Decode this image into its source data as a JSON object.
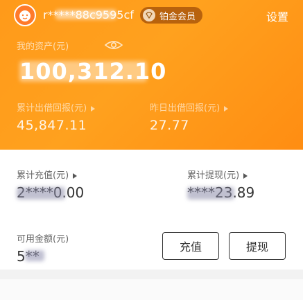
{
  "header": {
    "user_id": "r*****88c9595cf",
    "vip_label": "铂金会员",
    "settings_label": "设置"
  },
  "assets": {
    "label": "我的资产(元)",
    "value": "100,312.10"
  },
  "stats": {
    "total_return_label": "累计出借回报(元)",
    "total_return_value": "45,847.11",
    "yesterday_return_label": "昨日出借回报(元)",
    "yesterday_return_value": "27.77"
  },
  "account": {
    "total_recharge_label": "累计充值(元)",
    "total_recharge_value": "2****0.00",
    "total_withdraw_label": "累计提现(元)",
    "total_withdraw_value": "****23.89",
    "available_label": "可用金额(元)",
    "available_value": "5**"
  },
  "actions": {
    "recharge_label": "充值",
    "withdraw_label": "提现"
  },
  "colors": {
    "hero_orange": "#ffa11e",
    "vip_badge": "#b8620d"
  }
}
